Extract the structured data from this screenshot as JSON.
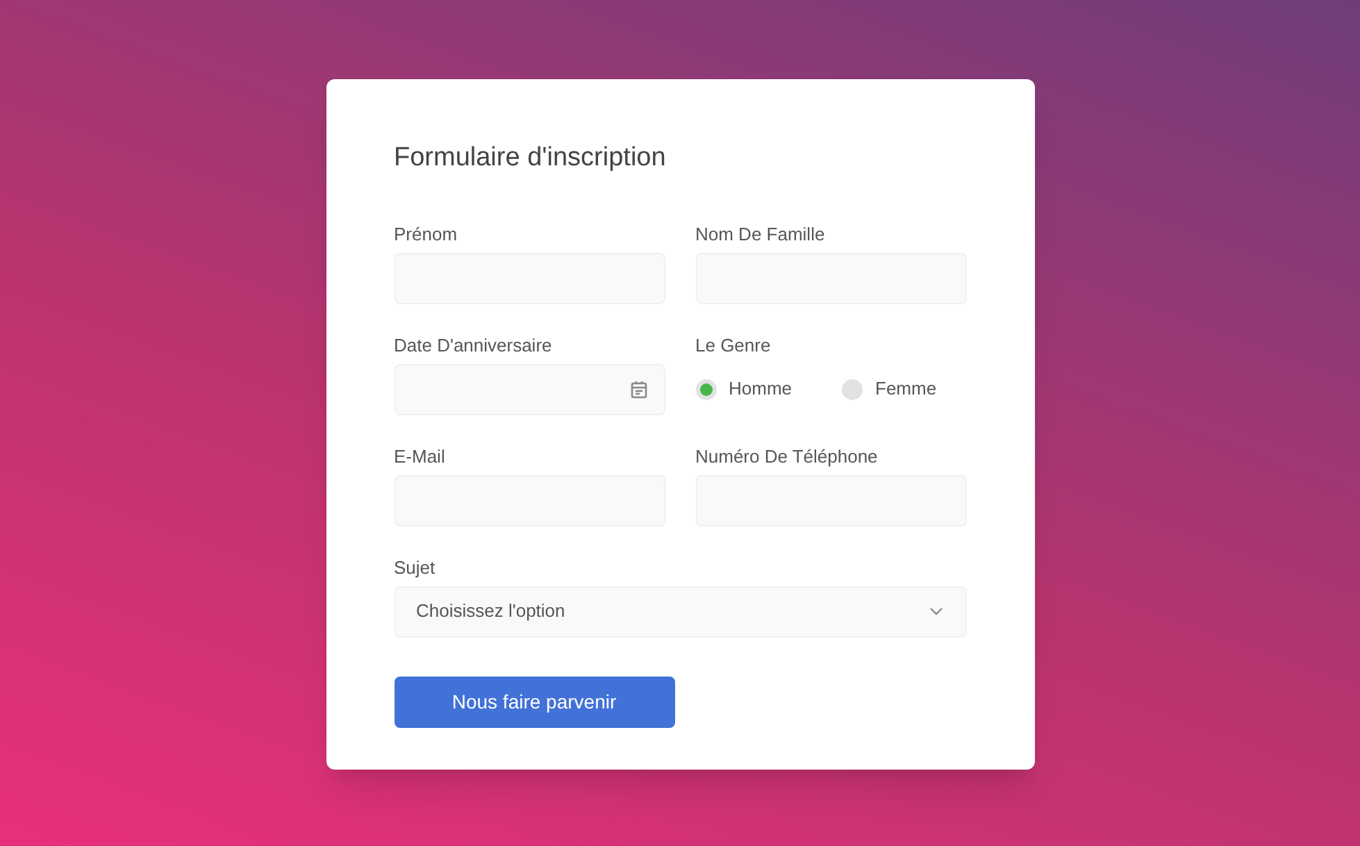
{
  "form": {
    "title": "Formulaire d'inscription",
    "fields": [
      {
        "kind": "text",
        "label": "Prénom"
      },
      {
        "kind": "text",
        "label": "Nom De Famille"
      },
      {
        "kind": "date",
        "label": "Date D'anniversaire"
      },
      {
        "kind": "radio",
        "label": "Le Genre",
        "options": [
          {
            "label": "Homme",
            "selected": true
          },
          {
            "label": "Femme",
            "selected": false
          }
        ]
      },
      {
        "kind": "text",
        "label": "E-Mail"
      },
      {
        "kind": "text",
        "label": "Numéro De Téléphone"
      },
      {
        "kind": "select",
        "label": "Sujet",
        "value": "Choisissez l'option"
      }
    ],
    "submit": "Nous faire parvenir"
  }
}
